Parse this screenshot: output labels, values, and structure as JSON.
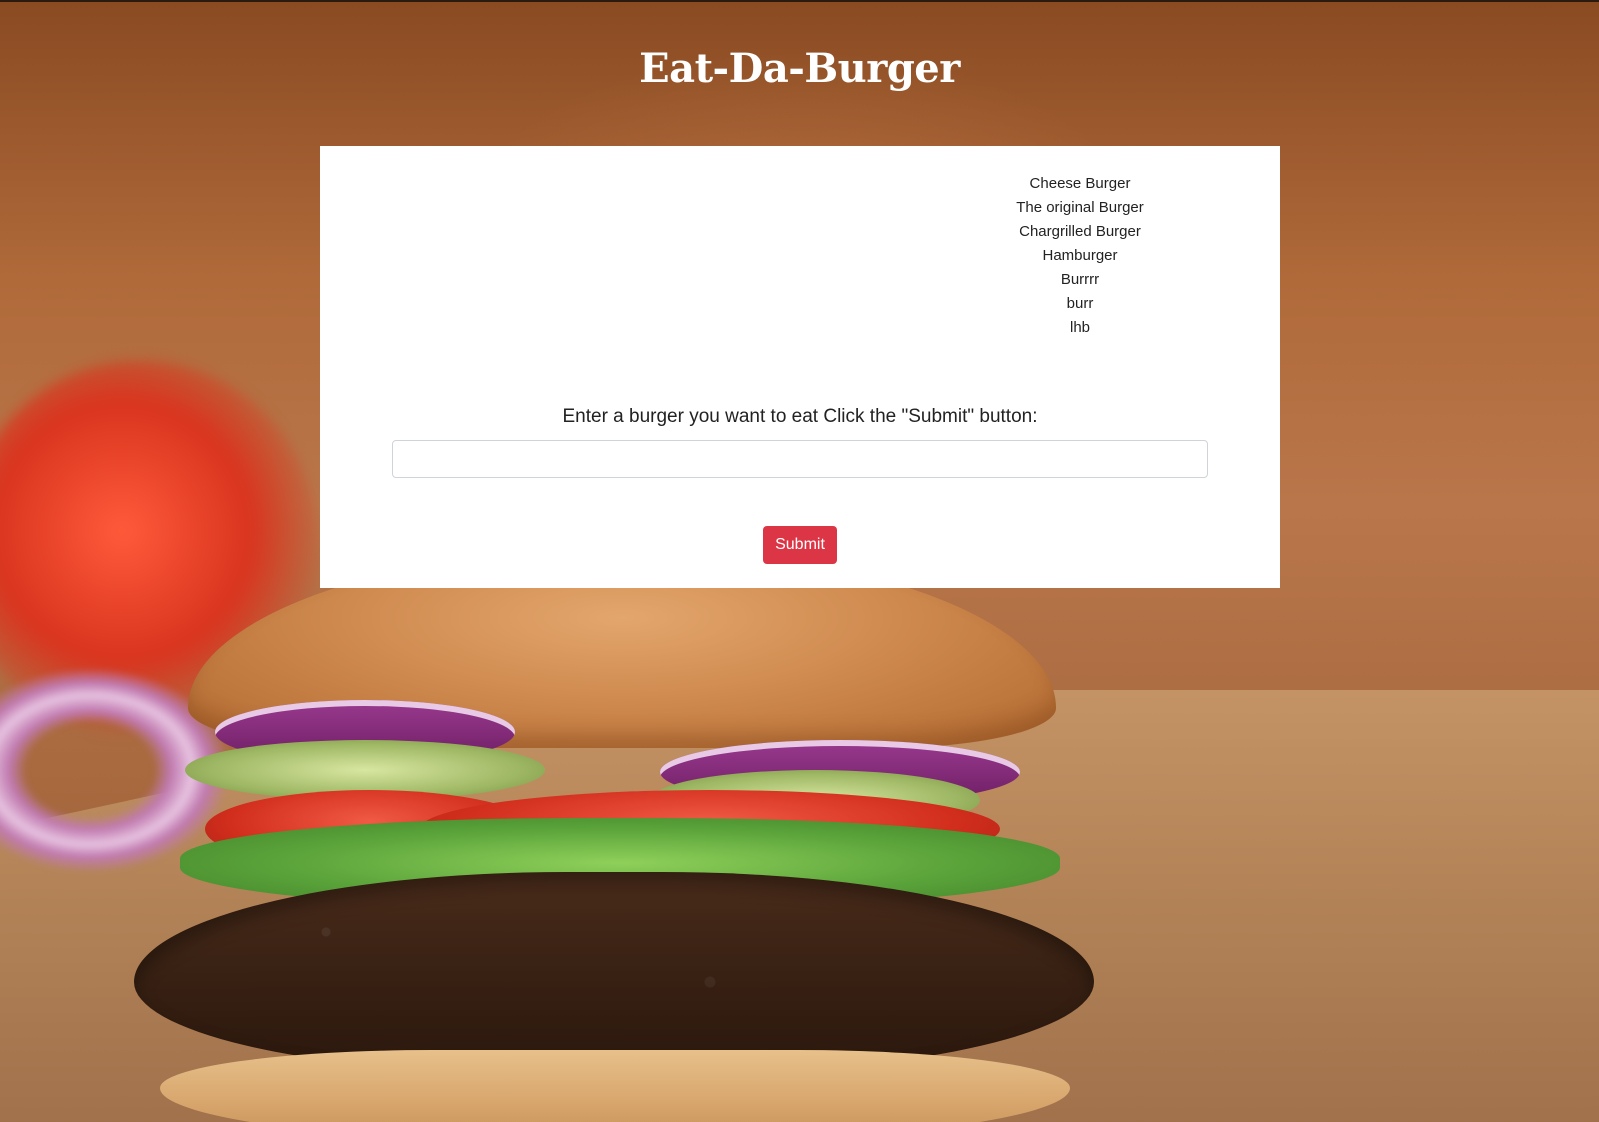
{
  "page": {
    "title": "Eat-Da-Burger"
  },
  "burgers": {
    "items": [
      "Cheese Burger",
      "The original Burger",
      "Chargrilled Burger",
      "Hamburger",
      "Burrrr",
      "burr",
      "lhb"
    ]
  },
  "form": {
    "instruction": "Enter a burger you want to eat Click the \"Submit\" button:",
    "input_value": "",
    "submit_label": "Submit"
  },
  "colors": {
    "submit_button": "#dc3545",
    "card_background": "#ffffff",
    "title_text": "#ffffff"
  }
}
